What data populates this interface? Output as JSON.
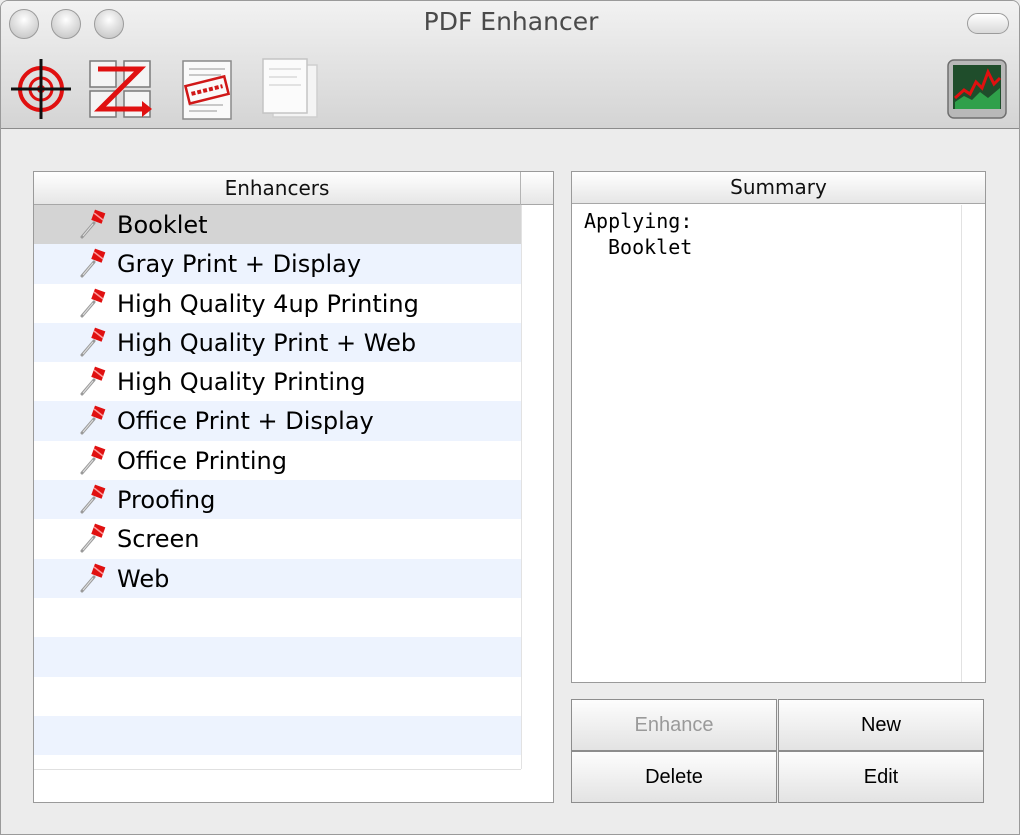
{
  "window": {
    "title": "PDF Enhancer"
  },
  "toolbar": {
    "icons": [
      "target-icon",
      "zoom-arrange-icon",
      "stamp-icon",
      "pages-icon",
      "graph-icon"
    ]
  },
  "enhancers": {
    "header": "Enhancers",
    "items": [
      {
        "label": "Booklet",
        "selected": true
      },
      {
        "label": "Gray Print + Display"
      },
      {
        "label": "High Quality 4up Printing"
      },
      {
        "label": "High Quality Print  + Web"
      },
      {
        "label": "High Quality Printing"
      },
      {
        "label": "Office Print + Display"
      },
      {
        "label": "Office Printing"
      },
      {
        "label": "Proofing"
      },
      {
        "label": "Screen"
      },
      {
        "label": "Web"
      }
    ]
  },
  "summary": {
    "header": "Summary",
    "line1": "Applying:",
    "line2": "Booklet"
  },
  "buttons": {
    "enhance": "Enhance",
    "new": "New",
    "delete": "Delete",
    "edit": "Edit"
  },
  "colors": {
    "accent_red": "#e01010",
    "selected_row": "#d4d4d4",
    "alt_row": "#edf3fe"
  }
}
